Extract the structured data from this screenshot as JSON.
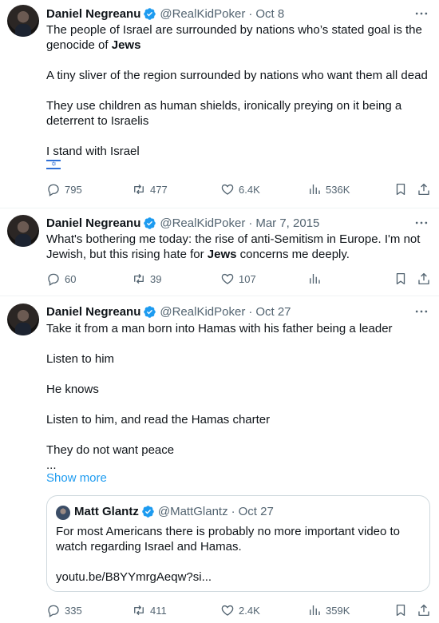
{
  "tweets": [
    {
      "author": "Daniel Negreanu",
      "handle": "@RealKidPoker",
      "separator": "·",
      "time": "Oct 8",
      "lines": {
        "l1": "The people of Israel are surrounded by nations who’s stated goal is the",
        "l2a": "genocide of ",
        "l2b": "Jews",
        "l3": "A tiny sliver of the region surrounded by nations who want them all dead",
        "l4": "They use children as human shields, ironically preying on it being a",
        "l5": "deterrent to Israelis",
        "l6": "I stand with Israel"
      },
      "flag": "🇮🇱",
      "flag_symbol": "✡",
      "replies": "795",
      "retweets": "477",
      "likes": "6.4K",
      "views": "536K"
    },
    {
      "author": "Daniel Negreanu",
      "handle": "@RealKidPoker",
      "separator": "·",
      "time": "Mar 7, 2015",
      "lines": {
        "l1": "What's bothering me today: the rise of anti-Semitism in Europe. I'm not",
        "l2a": "Jewish, but this rising hate for ",
        "l2b": "Jews",
        "l2c": " concerns me deeply."
      },
      "replies": "60",
      "retweets": "39",
      "likes": "107",
      "views": ""
    },
    {
      "author": "Daniel Negreanu",
      "handle": "@RealKidPoker",
      "separator": "·",
      "time": "Oct 27",
      "lines": {
        "l1": "Take it from a man born into Hamas with his father being a leader",
        "l2": "Listen to him",
        "l3": "He knows",
        "l4": "Listen to him, and read the Hamas charter",
        "l5": "They do not want peace",
        "l6": "..."
      },
      "show_more": "Show more",
      "quote": {
        "author": "Matt Glantz",
        "handle": "@MattGlantz",
        "separator": "·",
        "time": "Oct 27",
        "l1": "For most Americans there is probably no more important video to",
        "l2": "watch regarding Israel and Hamas.",
        "l3": "youtu.be/B8YYmrgAeqw?si..."
      },
      "replies": "335",
      "retweets": "411",
      "likes": "2.4K",
      "views": "359K"
    }
  ],
  "colors": {
    "text": "#0f1419",
    "secondary": "#536471",
    "link": "#1d9bf0",
    "verified": "#1d9bf0",
    "divider": "#eff3f4"
  },
  "icons": [
    "reply-icon",
    "retweet-icon",
    "like-icon",
    "views-icon",
    "bookmark-icon",
    "share-icon",
    "more-icon",
    "verified-icon"
  ]
}
